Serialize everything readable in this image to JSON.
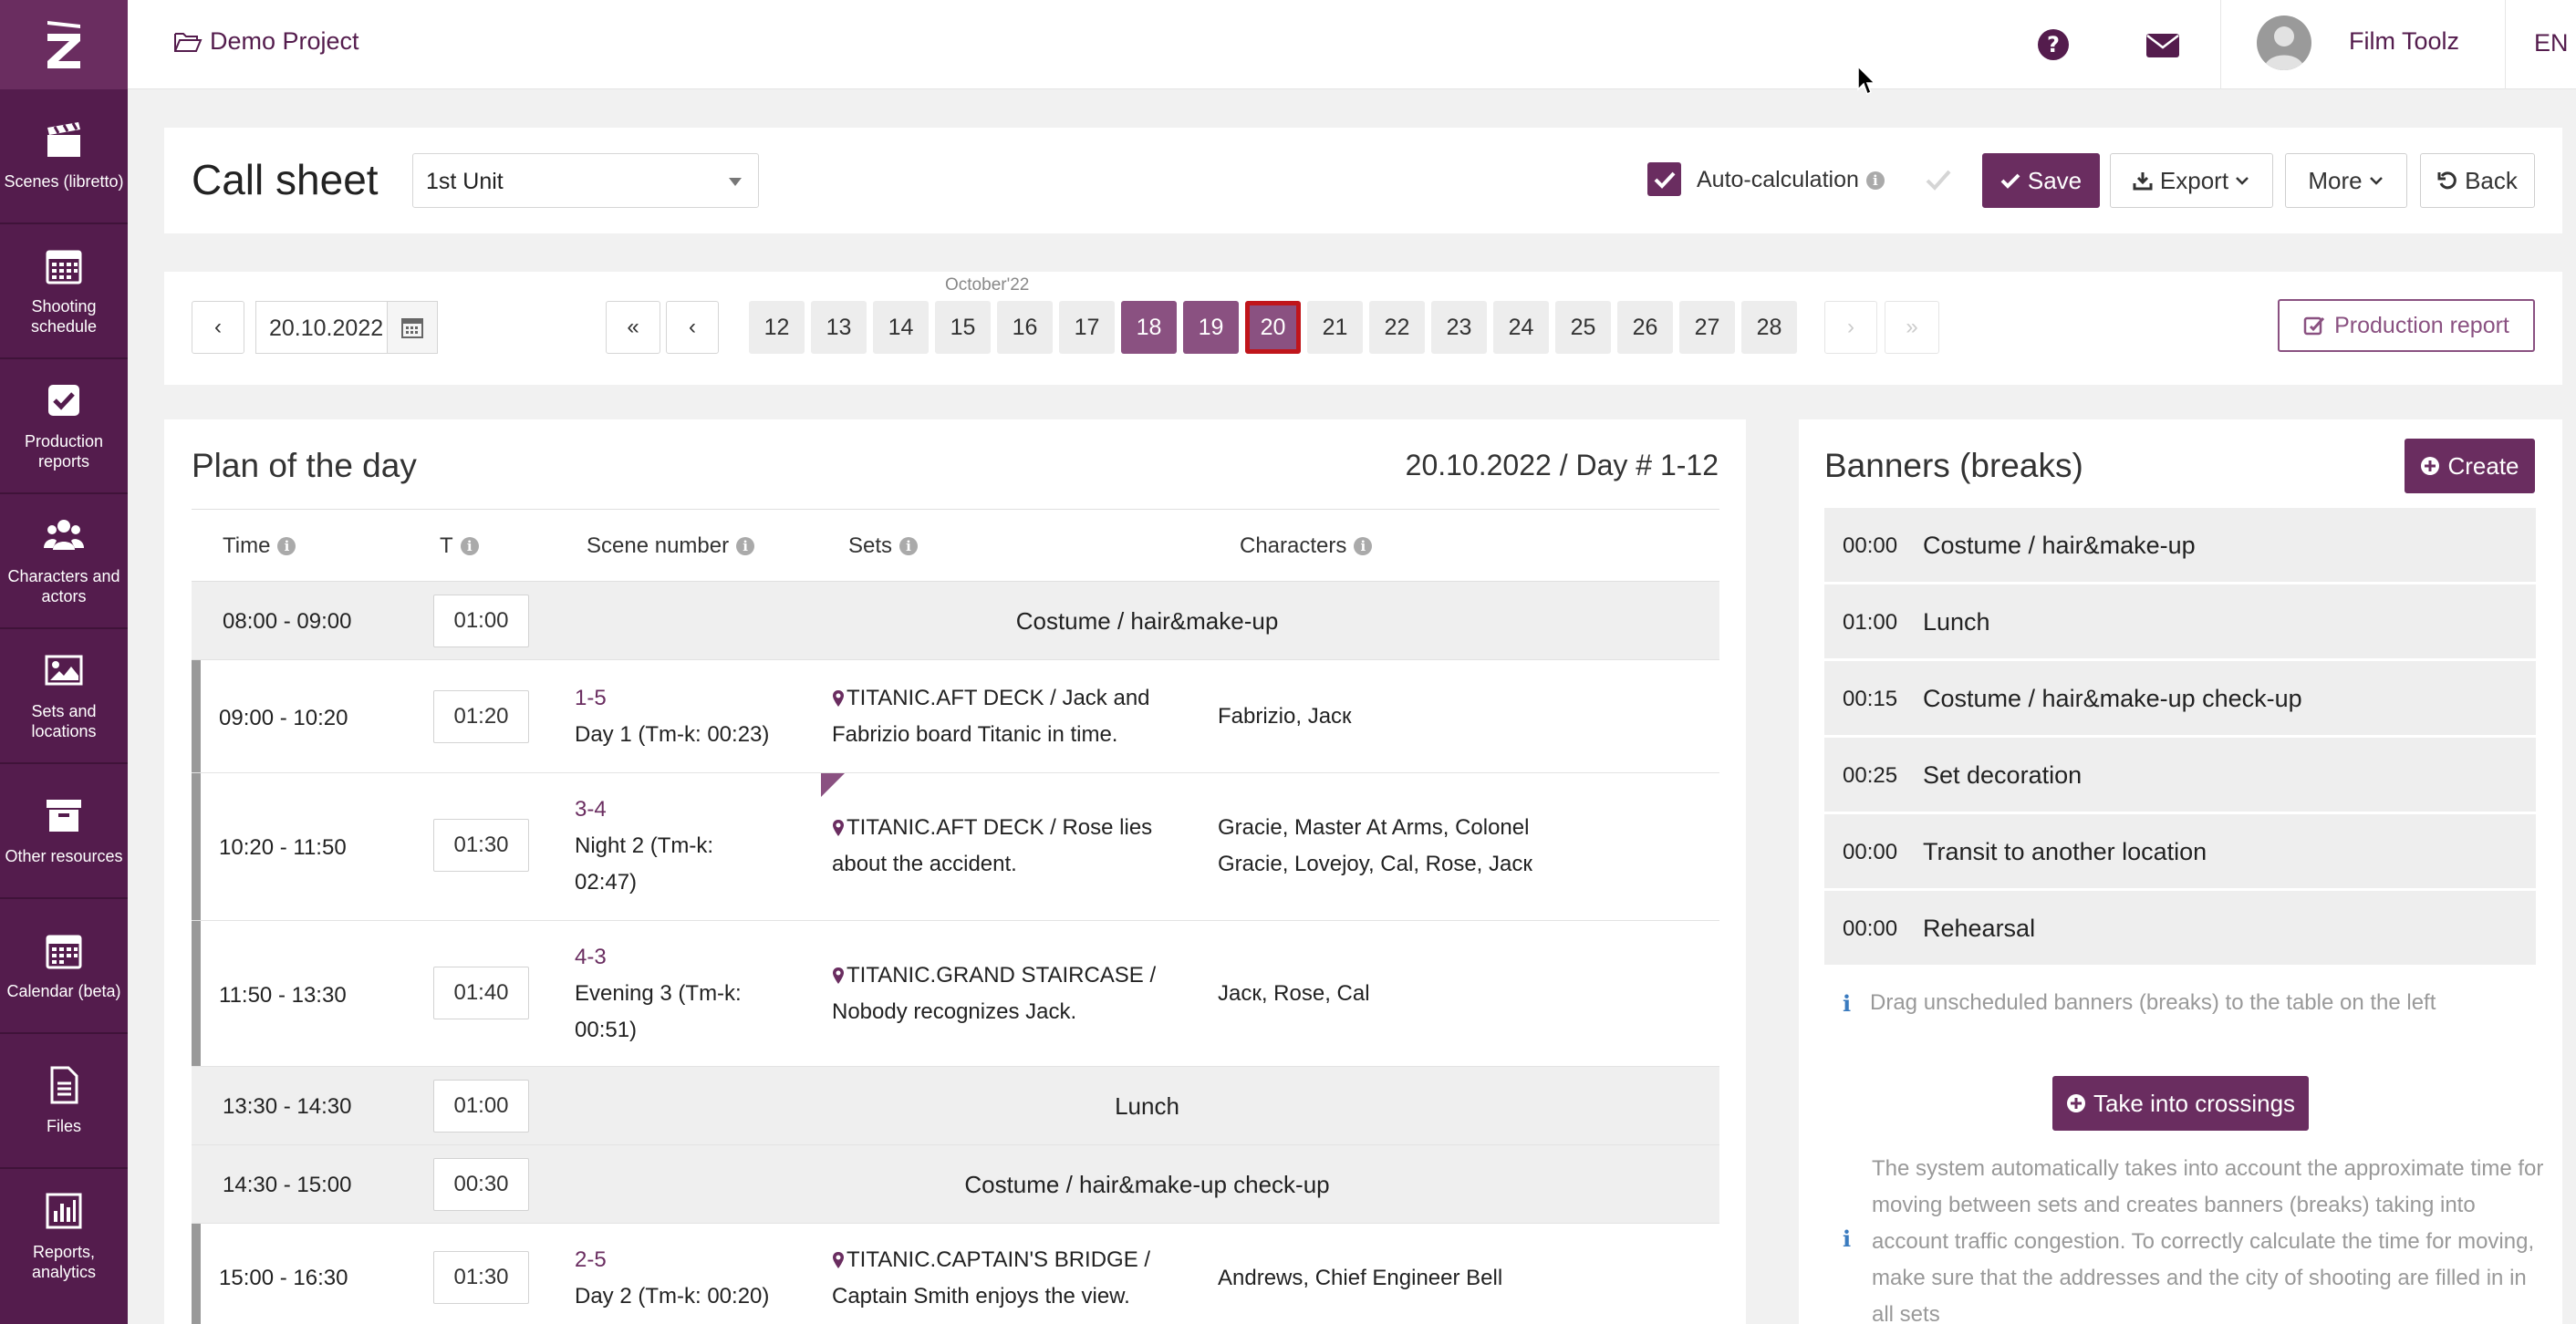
{
  "topbar": {
    "project": "Demo Project",
    "user": "Film Toolz",
    "lang": "EN"
  },
  "sidebar": {
    "items": [
      {
        "label": "Scenes (libretto)",
        "icon": "clapperboard-icon"
      },
      {
        "label": "Shooting schedule",
        "icon": "calendar-icon"
      },
      {
        "label": "Production reports",
        "icon": "checkbox-icon"
      },
      {
        "label": "Characters and actors",
        "icon": "users-icon"
      },
      {
        "label": "Sets and locations",
        "icon": "image-icon"
      },
      {
        "label": "Other resources",
        "icon": "archive-icon"
      },
      {
        "label": "Calendar (beta)",
        "icon": "calendar-grid-icon"
      },
      {
        "label": "Files",
        "icon": "file-icon"
      },
      {
        "label": "Reports, analytics",
        "icon": "bar-chart-icon"
      }
    ]
  },
  "header": {
    "title": "Call sheet",
    "unit": "1st Unit",
    "auto_calc": "Auto-calculation",
    "auto_calc_checked": true,
    "save": "Save",
    "export": "Export",
    "more": "More",
    "back": "Back"
  },
  "datebar": {
    "date": "20.10.2022",
    "month": "October'22",
    "days": [
      "12",
      "13",
      "14",
      "15",
      "16",
      "17",
      "18",
      "19",
      "20",
      "21",
      "22",
      "23",
      "24",
      "25",
      "26",
      "27",
      "28"
    ],
    "selected_days": [
      "18",
      "19"
    ],
    "current_day": "20",
    "prev": "‹",
    "next": "›",
    "first": "«",
    "last": "»",
    "production_report": "Production report"
  },
  "plan": {
    "title": "Plan of the day",
    "day_info": "20.10.2022 / Day # 1-12",
    "columns": [
      "Time",
      "T",
      "Scene number",
      "Sets",
      "Characters"
    ],
    "rows": [
      {
        "type": "banner",
        "time": "08:00 - 09:00",
        "dur": "01:00",
        "name": "Costume / hair&make-up"
      },
      {
        "type": "scene",
        "time": "09:00 - 10:20",
        "dur": "01:20",
        "num": "1-5",
        "desc": "Day 1 (Tm-k: 00:23)",
        "sets": "TITANIC.AFT DECK / Jack and Fabrizio board Titanic in time.",
        "chars": "Fabrizio, Jacк"
      },
      {
        "type": "scene",
        "time": "10:20 - 11:50",
        "dur": "01:30",
        "num": "3-4",
        "desc": "Night 2 (Tm-k: 02:47)",
        "sets": "TITANIC.AFT DECK / Rose lies about the accident.",
        "chars": "Gracie, Master At Arms, Colonel Gracie, Lovejoy, Cal, Rose, Jacк"
      },
      {
        "type": "scene",
        "time": "11:50 - 13:30",
        "dur": "01:40",
        "num": "4-3",
        "desc": "Evening 3 (Tm-k: 00:51)",
        "sets": "TITANIC.GRAND STAIRCASE / Nobody recognizes Jack.",
        "chars": "Jacк, Rose, Cal"
      },
      {
        "type": "banner",
        "time": "13:30 - 14:30",
        "dur": "01:00",
        "name": "Lunch"
      },
      {
        "type": "banner",
        "time": "14:30 - 15:00",
        "dur": "00:30",
        "name": "Costume / hair&make-up check-up"
      },
      {
        "type": "scene",
        "time": "15:00 - 16:30",
        "dur": "01:30",
        "num": "2-5",
        "desc": "Day 2 (Tm-k: 00:20)",
        "sets": "TITANIC.CAPTAIN'S BRIDGE / Captain Smith enjoys the view.",
        "chars": "Andrews, Chief Engineer Bell"
      }
    ]
  },
  "banners": {
    "title": "Banners (breaks)",
    "create": "Create",
    "items": [
      {
        "time": "00:00",
        "name": "Costume / hair&make-up"
      },
      {
        "time": "01:00",
        "name": "Lunch"
      },
      {
        "time": "00:15",
        "name": "Costume / hair&make-up check-up"
      },
      {
        "time": "00:25",
        "name": "Set decoration"
      },
      {
        "time": "00:00",
        "name": "Transit to another location"
      },
      {
        "time": "00:00",
        "name": "Rehearsal"
      }
    ],
    "hint": "Drag unscheduled banners (breaks) to the table on the left",
    "crossings": "Take into crossings",
    "note": "The system automatically takes into account the approximate time for moving between sets and creates banners (breaks) taking into account traffic congestion. To correctly calculate the time for moving, make sure that the addresses and the city of shooting are filled in in all sets"
  },
  "colors": {
    "brand": "#541c4d",
    "accent": "#6a2d60",
    "selected_day": "#8a5181",
    "current_day_border": "#c0151b"
  }
}
